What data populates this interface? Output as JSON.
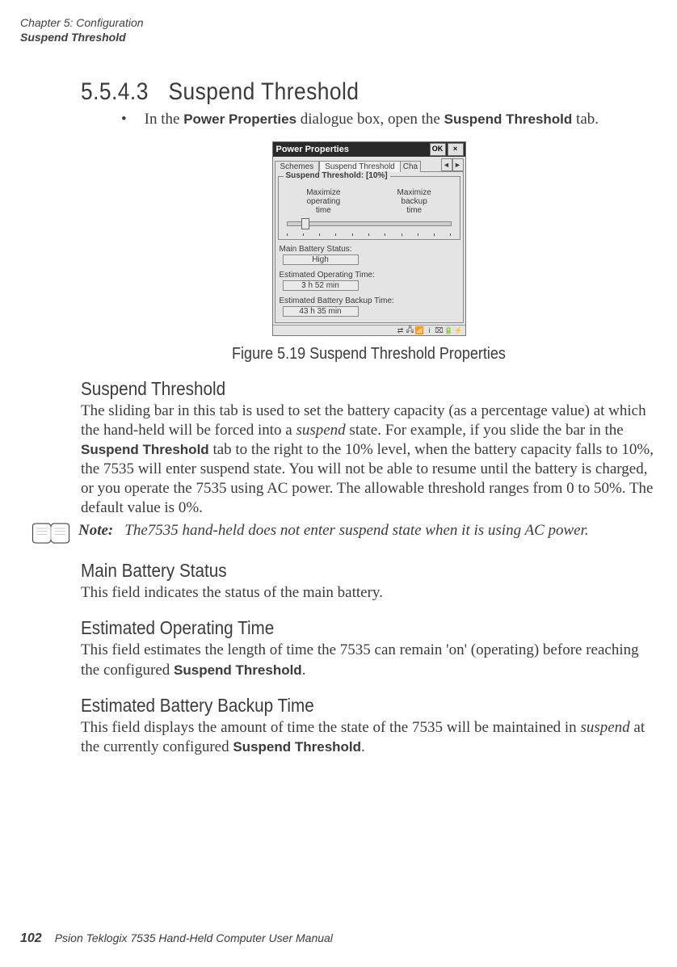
{
  "header": {
    "line1": "Chapter 5: Configuration",
    "line2": "Suspend Threshold"
  },
  "section": {
    "number": "5.5.4.3",
    "title": "Suspend Threshold",
    "bullet_prefix": "In the ",
    "power_properties_label": "Power Properties",
    "bullet_mid": " dialogue box, open the ",
    "suspend_threshold_label": "Suspend Threshold",
    "bullet_suffix": " tab."
  },
  "dialog": {
    "title": "Power Properties",
    "ok": "OK",
    "close": "×",
    "tabs": {
      "schemes": "Schemes",
      "suspend": "Suspend Threshold",
      "partial": "Cha",
      "arrow_left": "◄",
      "arrow_right": "►"
    },
    "group_legend_prefix": "Suspend Threshold: [",
    "group_legend_value": "10%",
    "group_legend_suffix": "]",
    "left_label_l1": "Maximize",
    "left_label_l2": "operating",
    "left_label_l3": "time",
    "right_label_l1": "Maximize",
    "right_label_l2": "backup",
    "right_label_l3": "time",
    "main_status_label": "Main Battery Status:",
    "main_status_value": "High",
    "est_op_label": "Estimated Operating Time:",
    "est_op_value": "3 h 52 min",
    "est_backup_label": "Estimated Battery Backup Time:",
    "est_backup_value": "43 h 35 min"
  },
  "figure_caption": "Figure 5.19 Suspend Threshold Properties",
  "subsections": {
    "s1_title": "Suspend Threshold",
    "s1_p_a": "The sliding bar in this tab is used to set the battery capacity (as a percentage value) at which the hand-held will be forced into a ",
    "s1_p_suspend": "suspend",
    "s1_p_b": " state. For example, if you slide the bar in the ",
    "s1_p_bold": "Suspend Threshold",
    "s1_p_c": " tab to the right to the 10% level, when the battery capacity falls to 10%, the 7535 will enter suspend state. You will not be able to resume until the battery is charged, or you operate the 7535 using AC power. The allowable threshold ranges from 0 to 50%. The default value is 0%.",
    "note_label": "Note:",
    "note_text": "The7535 hand-held does not enter suspend state when it is using AC power.",
    "s2_title": "Main Battery Status",
    "s2_p": "This field indicates the status of the main battery.",
    "s3_title": "Estimated Operating Time",
    "s3_p_a": "This field estimates the length of time the 7535 can remain 'on' (operating) before reaching the configured ",
    "s3_p_bold": "Suspend Threshold",
    "s3_p_b": ".",
    "s4_title": "Estimated Battery Backup Time",
    "s4_p_a": "This field displays the amount of time the state of the 7535 will be maintained in ",
    "s4_p_suspend": "suspend",
    "s4_p_b": " at the currently configured ",
    "s4_p_bold": "Suspend Threshold",
    "s4_p_c": "."
  },
  "footer": {
    "page": "102",
    "text": "Psion Teklogix 7535 Hand-Held Computer User Manual"
  }
}
